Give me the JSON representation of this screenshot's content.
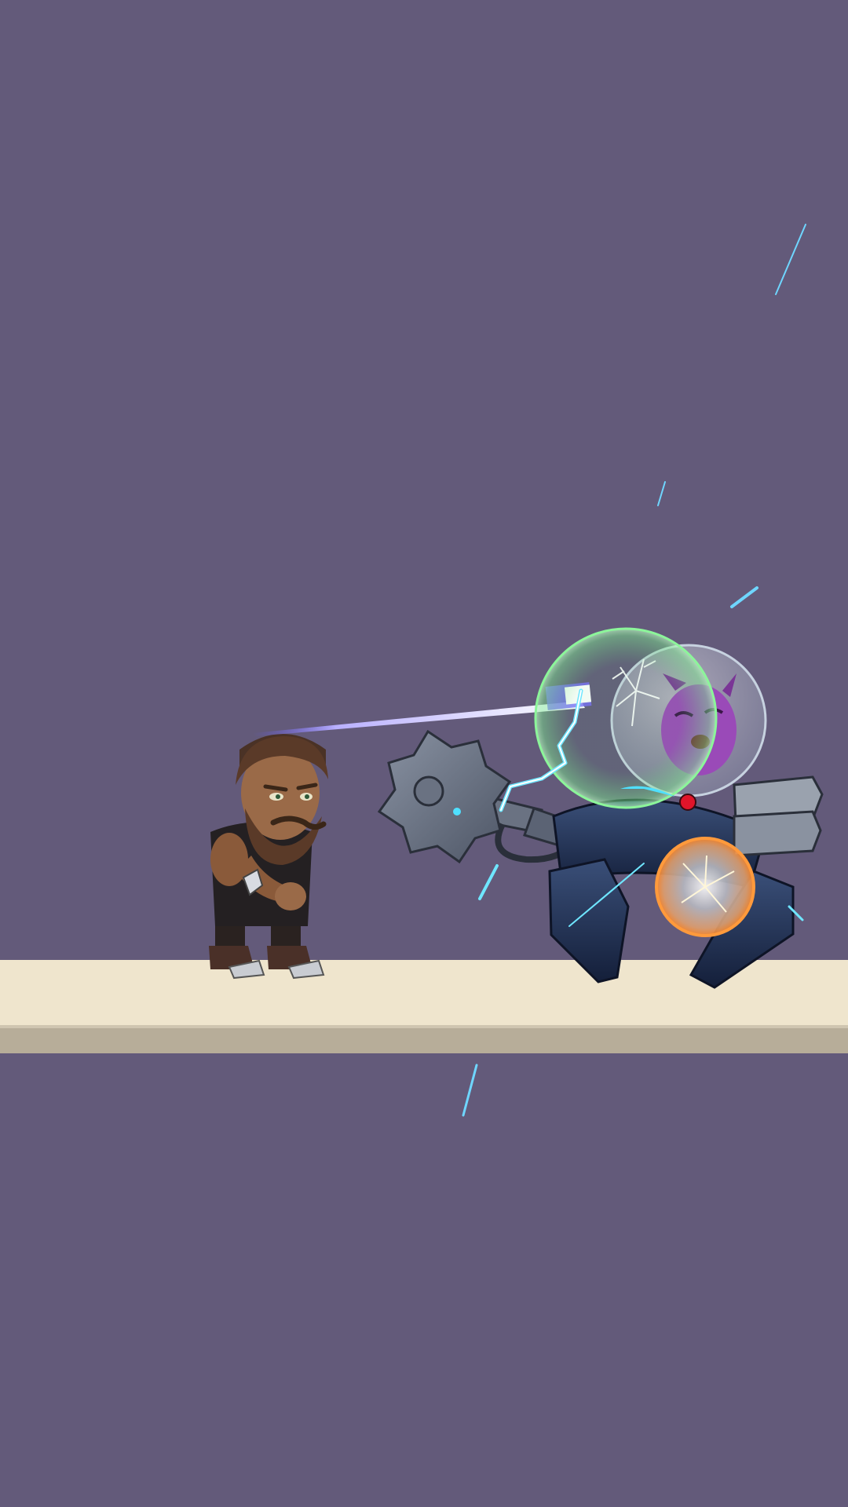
{
  "scene": {
    "type": "battle-scene",
    "colors": {
      "background": "#635a7a",
      "platform_top": "#efe5cd",
      "platform_edge": "#b7ad99",
      "laser": "#7b6cff",
      "shield": "#6fe38a",
      "energy_orb": "#ff9a3c",
      "spark": "#4fe0ff"
    },
    "hero": {
      "name": "bearded-warrior",
      "facing": "right"
    },
    "enemy": {
      "name": "alien-robot-mech",
      "weapon": "buzzsaw-arm",
      "pilot": "purple-alien-in-glass-dome"
    },
    "effects": [
      "laser-beam",
      "green-shield-bubble",
      "cracked-dome",
      "orange-energy-orb",
      "electric-sparks"
    ]
  }
}
